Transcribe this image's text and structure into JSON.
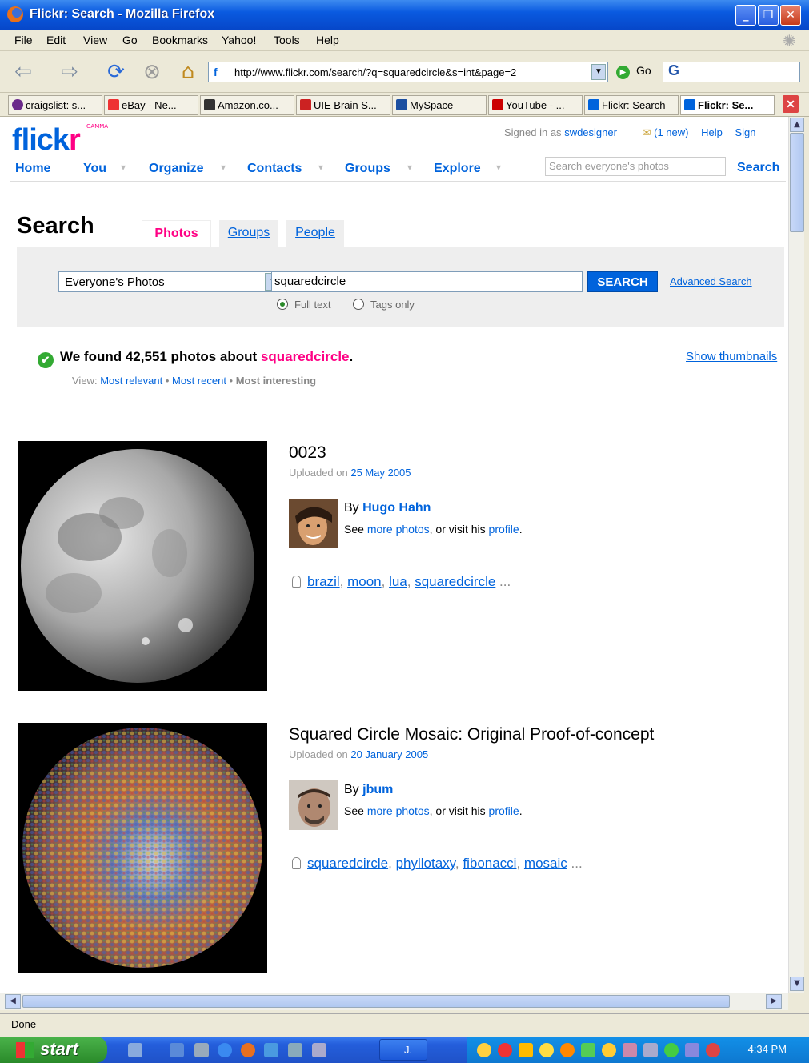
{
  "window": {
    "title": "Flickr: Search - Mozilla Firefox",
    "buttons": [
      "_",
      "❐",
      "✕"
    ]
  },
  "menu": [
    "File",
    "Edit",
    "View",
    "Go",
    "Bookmarks",
    "Yahoo!",
    "Tools",
    "Help"
  ],
  "nav": {
    "url": "http://www.flickr.com/search/?q=squaredcircle&s=int&page=2",
    "go_label": "Go",
    "google_box": "G"
  },
  "bookmarks": [
    {
      "label": "craigslist: s...",
      "color": "#6a2a8a"
    },
    {
      "label": "eBay - Ne...",
      "color": "#e33"
    },
    {
      "label": "Amazon.co...",
      "color": "#333"
    },
    {
      "label": "UIE Brain S...",
      "color": "#c22"
    },
    {
      "label": "MySpace",
      "color": "#1c4fa0"
    },
    {
      "label": "YouTube - ...",
      "color": "#c00"
    },
    {
      "label": "Flickr: Search",
      "color": "#0063dc"
    },
    {
      "label": "Flickr: Se...",
      "color": "#0063dc"
    }
  ],
  "flickr": {
    "logo_a": "flick",
    "logo_b": "r",
    "gamma": "GAMMA",
    "signed_in_prefix": "Signed in as",
    "username": "swdesigner",
    "new_mail": "(1 new)",
    "help": "Help",
    "sign": "Sign",
    "nav": [
      "Home",
      "You",
      "Organize",
      "Contacts",
      "Groups",
      "Explore"
    ],
    "top_search_placeholder": "Search everyone's photos",
    "top_search_button": "Search"
  },
  "search": {
    "heading": "Search",
    "tabs": [
      "Photos",
      "Groups",
      "People"
    ],
    "scope": "Everyone's Photos",
    "query": "squaredcircle",
    "button": "SEARCH",
    "advanced": "Advanced Search",
    "radio_full": "Full text",
    "radio_tags": "Tags only",
    "found_prefix": "We found 42,551 photos about",
    "found_query": "squaredcircle",
    "found_suffix": ".",
    "show_thumbnails": "Show thumbnails",
    "view_label": "View:",
    "view_options": [
      "Most relevant",
      "Most recent",
      "Most interesting"
    ]
  },
  "results": [
    {
      "title": "0023",
      "uploaded_prefix": "Uploaded on",
      "date": "25 May 2005",
      "by": "By",
      "user": "Hugo Hahn",
      "see": "See",
      "more_photos": "more photos",
      "or_visit": ", or visit his",
      "profile": "profile",
      "tags": [
        "brazil",
        "moon",
        "lua",
        "squaredcircle"
      ],
      "ellipsis": "..."
    },
    {
      "title": "Squared Circle Mosaic: Original Proof-of-concept",
      "uploaded_prefix": "Uploaded on",
      "date": "20 January 2005",
      "by": "By",
      "user": "jbum",
      "see": "See",
      "more_photos": "more photos",
      "or_visit": ", or visit his",
      "profile": "profile",
      "tags": [
        "squaredcircle",
        "phyllotaxy",
        "fibonacci",
        "mosaic"
      ],
      "ellipsis": "..."
    }
  ],
  "status": "Done",
  "taskbar": {
    "start": "start",
    "task": "J.",
    "clock": "4:34 PM"
  },
  "colors": {
    "flickr_blue": "#0063dc",
    "flickr_pink": "#ff0084",
    "xp_blue": "#0a5ae0"
  }
}
